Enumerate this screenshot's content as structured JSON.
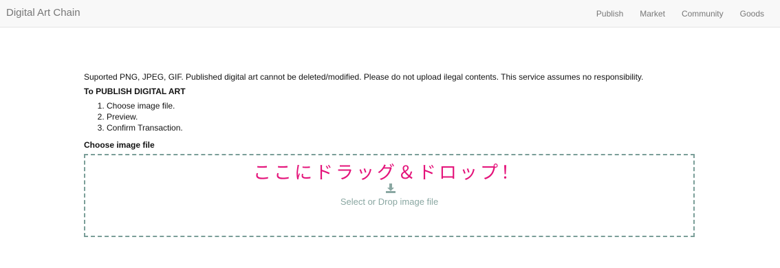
{
  "navbar": {
    "brand": "Digital Art Chain",
    "links": [
      "Publish",
      "Market",
      "Community",
      "Goods"
    ]
  },
  "main": {
    "notice": "Suported PNG, JPEG, GIF. Published digital art cannot be deleted/modified. Please do not upload ilegal contents. This service assumes no responsibility.",
    "publish_title": "To PUBLISH DIGITAL ART",
    "steps": [
      "Choose image file.",
      "Preview.",
      "Confirm Transaction."
    ],
    "choose_label": "Choose image file"
  },
  "dropzone": {
    "annotation": "ここにドラッグ＆ドロップ！",
    "text": "Select or Drop image file",
    "icon": "upload-icon",
    "annotation_color": "#e4137a",
    "border_color": "#7a9e98"
  }
}
